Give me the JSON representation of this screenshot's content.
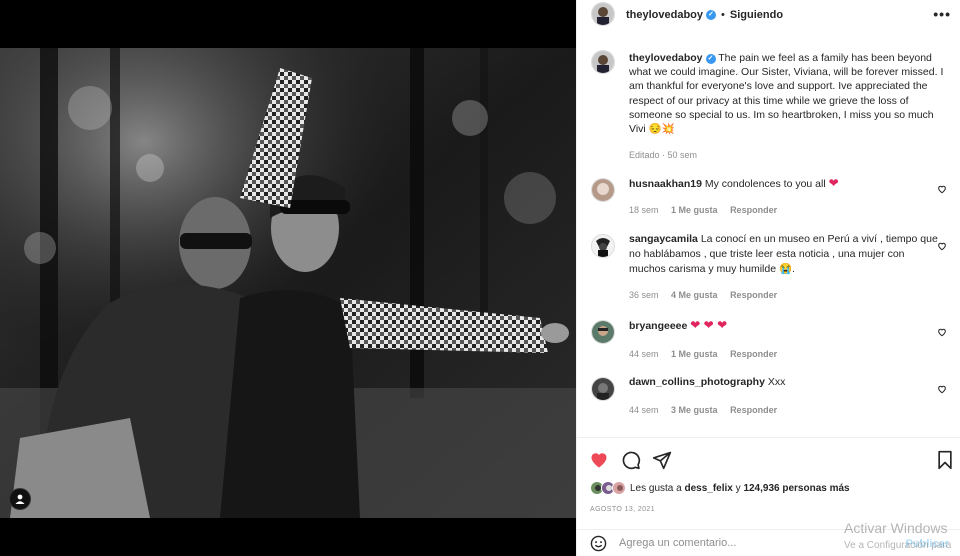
{
  "post": {
    "username": "theylovedaboy",
    "header_separator": "•",
    "follow_label": "Siguiendo",
    "more_icon": "more-options-icon",
    "more_label": "•••",
    "caption": "The pain we feel as a family has been beyond what we could imagine. Our Sister, Viviana, will be forever missed. I am thankful for everyone's love and support. Ive appreciated the respect of our privacy at this time while we grieve the loss of someone so special to us. Im so heartbroken, I miss you so much Vivi 😔💥",
    "caption_meta": "Editado · 50 sem",
    "verified_mark": "✓"
  },
  "comments": [
    {
      "username": "husnaakhan19",
      "text": "My condolences to you all",
      "emoji": "❤",
      "time": "18 sem",
      "likes": "1 Me gusta",
      "reply": "Responder"
    },
    {
      "username": "sangaycamila",
      "text": "La conocí en un museo en Perú a viví , tiempo que no hablábamos , que triste leer esta noticia , una mujer con muchos carisma y muy humilde 😭.",
      "emoji": "",
      "time": "36 sem",
      "likes": "4 Me gusta",
      "reply": "Responder"
    },
    {
      "username": "bryangeeee",
      "text": "",
      "emoji": "❤ ❤ ❤",
      "time": "44 sem",
      "likes": "1 Me gusta",
      "reply": "Responder"
    },
    {
      "username": "dawn_collins_photography",
      "text": "Xxx",
      "emoji": "",
      "time": "44 sem",
      "likes": "3 Me gusta",
      "reply": "Responder"
    }
  ],
  "likes_summary": {
    "prefix": "Les gusta a",
    "user": "dess_felix",
    "joiner": "y",
    "count": "124,936 personas más"
  },
  "date": "AGOSTO 13, 2021",
  "compose": {
    "placeholder": "Agrega un comentario...",
    "publish": "Publicar"
  },
  "watermark": {
    "line1": "Activar Windows",
    "line2": "Ve a Configuración para"
  },
  "colors": {
    "like_red": "#ed4956",
    "verified_blue": "#3897f0",
    "publish_disabled": "#b2dffc"
  }
}
